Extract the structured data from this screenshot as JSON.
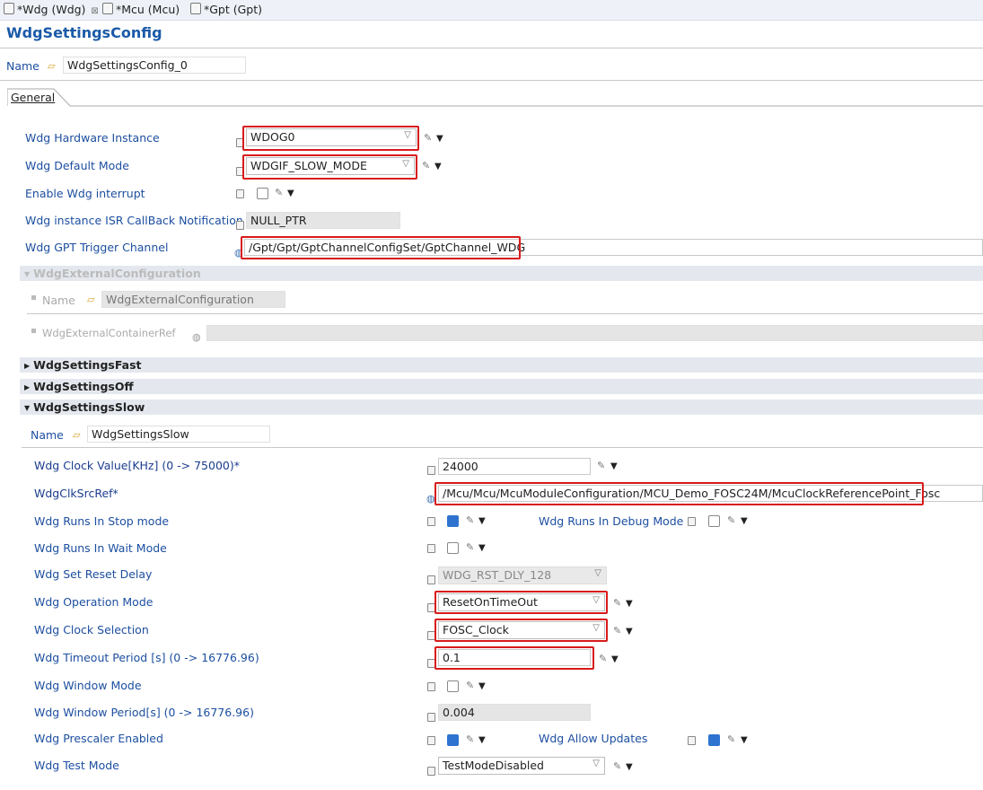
{
  "tabs": [
    {
      "label": "*Wdg (Wdg)",
      "close": "⊠"
    },
    {
      "label": "*Mcu (Mcu)"
    },
    {
      "label": "*Gpt (Gpt)"
    }
  ],
  "header": {
    "title": "WdgSettingsConfig"
  },
  "name_row": {
    "label": "Name",
    "value": "WdgSettingsConfig_0"
  },
  "general_tab": "General",
  "fields": {
    "hw_instance": {
      "label": "Wdg Hardware Instance",
      "value": "WDOG0"
    },
    "default_mode": {
      "label": "Wdg Default Mode",
      "value": "WDGIF_SLOW_MODE"
    },
    "enable_interrupt": {
      "label": "Enable Wdg interrupt",
      "checked": false
    },
    "isr_callback": {
      "label": "Wdg instance ISR CallBack Notification",
      "value": "NULL_PTR"
    },
    "gpt_trigger": {
      "label": "Wdg GPT Trigger Channel",
      "value": "/Gpt/Gpt/GptChannelConfigSet/GptChannel_WDG"
    }
  },
  "external_config": {
    "title": "WdgExternalConfiguration",
    "name_label": "Name",
    "name_value": "WdgExternalConfiguration",
    "container_ref_label": "WdgExternalContainerRef"
  },
  "sections": {
    "fast": "WdgSettingsFast",
    "off": "WdgSettingsOff",
    "slow": "WdgSettingsSlow"
  },
  "slow": {
    "name_label": "Name",
    "name_value": "WdgSettingsSlow",
    "clock_value": {
      "label": "Wdg Clock Value[KHz] (0 -> 75000)*",
      "value": "24000"
    },
    "clk_src_ref": {
      "label": "WdgClkSrcRef*",
      "value": "/Mcu/Mcu/McuModuleConfiguration/MCU_Demo_FOSC24M/McuClockReferencePoint_Fosc"
    },
    "runs_stop": {
      "label": "Wdg Runs In Stop mode",
      "checked": true
    },
    "runs_debug": {
      "label": "Wdg Runs In Debug Mode",
      "checked": false
    },
    "runs_wait": {
      "label": "Wdg Runs In Wait Mode",
      "checked": false
    },
    "reset_delay": {
      "label": "Wdg Set Reset Delay",
      "value": "WDG_RST_DLY_128"
    },
    "op_mode": {
      "label": "Wdg Operation Mode",
      "value": "ResetOnTimeOut"
    },
    "clock_sel": {
      "label": "Wdg Clock Selection",
      "value": "FOSC_Clock"
    },
    "timeout": {
      "label": "Wdg Timeout Period [s] (0 -> 16776.96)",
      "value": "0.1"
    },
    "window_mode": {
      "label": "Wdg Window Mode",
      "checked": false
    },
    "window_period": {
      "label": "Wdg Window Period[s] (0 -> 16776.96)",
      "value": "0.004"
    },
    "prescaler": {
      "label": "Wdg Prescaler Enabled",
      "checked": true
    },
    "allow_updates": {
      "label": "Wdg Allow Updates",
      "checked": true
    },
    "test_mode": {
      "label": "Wdg Test Mode",
      "value": "TestModeDisabled"
    }
  },
  "colors": {
    "label_blue": "#1d4fa0",
    "highlight_red": "#d81b1b",
    "section_bg": "#e4e8ee",
    "check_blue": "#2f73d0"
  }
}
